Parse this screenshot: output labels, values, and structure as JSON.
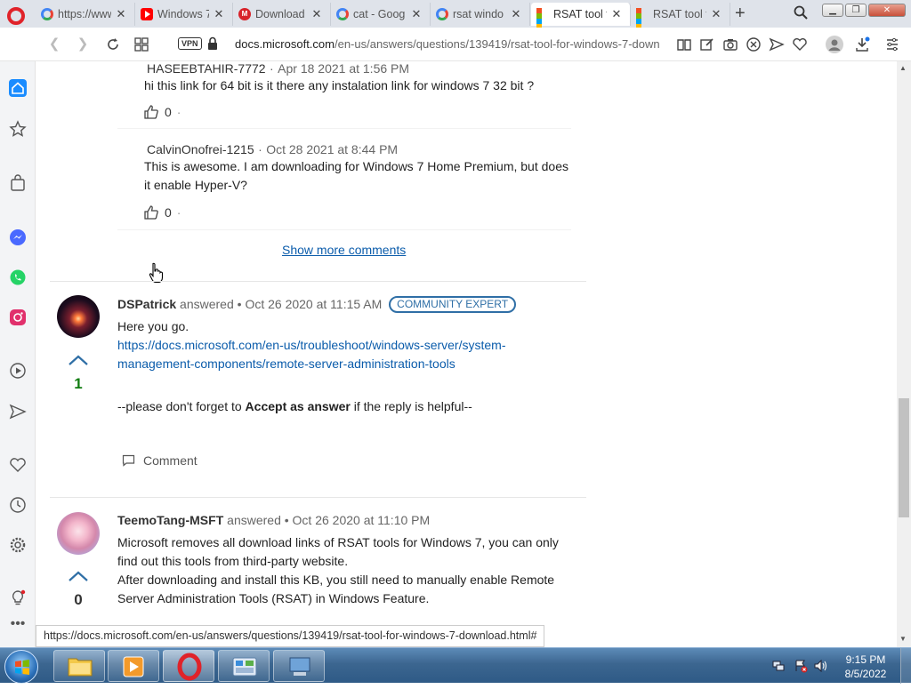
{
  "tabs": [
    {
      "title": "https://www",
      "icon": "google-icon"
    },
    {
      "title": "Windows 7 ",
      "icon": "youtube-icon"
    },
    {
      "title": "Download",
      "icon": "m-icon"
    },
    {
      "title": "cat - Goog",
      "icon": "google-icon"
    },
    {
      "title": "rsat windo",
      "icon": "google-icon"
    },
    {
      "title": "RSAT tool f",
      "icon": "microsoft-icon",
      "active": true
    },
    {
      "title": "RSAT tool f",
      "icon": "microsoft-icon"
    }
  ],
  "toolbar": {
    "vpn_label": "VPN",
    "url_domain": "docs.microsoft.com",
    "url_path": "/en-us/answers/questions/139419/rsat-tool-for-windows-7-down"
  },
  "comments": [
    {
      "author": "HASEEBTAHIR-7772",
      "date": "Apr 18 2021 at 1:56 PM",
      "text": "hi this link for 64 bit is it there any instalation link for windows 7 32 bit ?",
      "likes": "0"
    },
    {
      "author": "CalvinOnofrei-1215",
      "date": "Oct 28 2021 at 8:44 PM",
      "text_line1": "This is awesome. I am downloading for Windows 7 Home Premium, but does",
      "text_line2": "it enable Hyper-V?",
      "likes": "0"
    }
  ],
  "show_more_comments": "Show more comments",
  "answers": [
    {
      "author": "DSPatrick",
      "verb": "answered",
      "date": "Oct 26 2020 at 11:15 AM",
      "badge": "COMMUNITY EXPERT",
      "votes": "1",
      "line1": "Here you go.",
      "link_line1": "https://docs.microsoft.com/en-us/troubleshoot/windows-server/system-",
      "link_line2": "management-components/remote-server-administration-tools",
      "footer_pre": "--please don't forget to ",
      "footer_bold": "Accept as answer",
      "footer_post": " if the reply is helpful--",
      "comment_label": "Comment"
    },
    {
      "author": "TeemoTang-MSFT",
      "verb": "answered",
      "date": "Oct 26 2020 at 11:10 PM",
      "votes": "0",
      "line1": "Microsoft removes all download links of RSAT tools for Windows 7, you can only",
      "line2": "find out this tools from third-party website.",
      "line3": "After downloading and install this KB, you still need to manually enable Remote",
      "line4": "Server Administration Tools (RSAT) in Windows Feature."
    }
  ],
  "status_url": "https://docs.microsoft.com/en-us/answers/questions/139419/rsat-tool-for-windows-7-download.html#",
  "taskbar": {
    "time": "9:15 PM",
    "date": "8/5/2022"
  },
  "colors": {
    "link": "#0b5cab",
    "vote_up_arrow": "#2f6fa6",
    "vote_count_green": "#107c10",
    "badge": "#2f6fa6"
  }
}
